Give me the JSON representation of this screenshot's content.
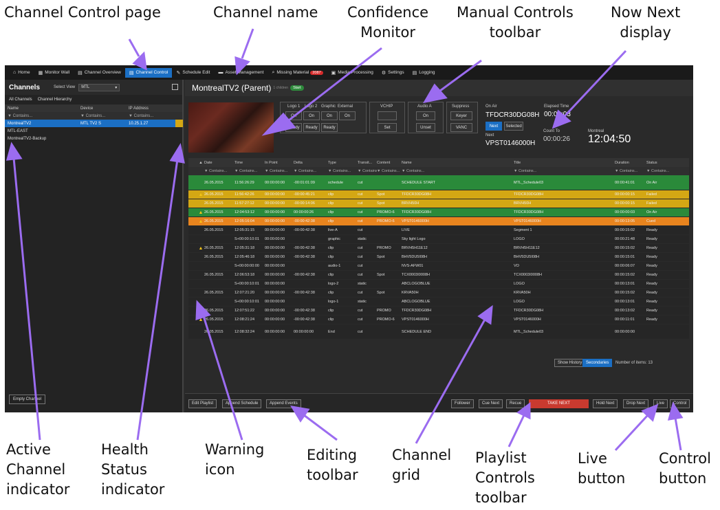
{
  "callouts": {
    "channel_control_page": "Channel Control page",
    "channel_name": "Channel name",
    "confidence_monitor": "Confidence\nMonitor",
    "manual_controls_toolbar": "Manual Controls\ntoolbar",
    "now_next_display": "Now Next\ndisplay",
    "active_channel_indicator": "Active\nChannel\nindicator",
    "health_status_indicator": "Health\nStatus\nindicator",
    "warning_icon": "Warning\nicon",
    "editing_toolbar": "Editing\ntoolbar",
    "channel_grid": "Channel\ngrid",
    "playlist_controls_toolbar": "Playlist\nControls\ntoolbar",
    "live_button": "Live\nbutton",
    "control_button": "Control\nbutton"
  },
  "nav": [
    {
      "icon": "⌂",
      "label": "Home"
    },
    {
      "icon": "▦",
      "label": "Monitor Wall"
    },
    {
      "icon": "▤",
      "label": "Channel Overview"
    },
    {
      "icon": "▤",
      "label": "Channel Control",
      "active": true
    },
    {
      "icon": "✎",
      "label": "Schedule Edit"
    },
    {
      "icon": "▬",
      "label": "Asset Management"
    },
    {
      "icon": "⌕",
      "label": "Missing Material",
      "badge": "2087"
    },
    {
      "icon": "▣",
      "label": "Media Processing"
    },
    {
      "icon": "⚙",
      "label": "Settings"
    },
    {
      "icon": "▤",
      "label": "Logging"
    }
  ],
  "left": {
    "title": "Channels",
    "select_view_label": "Select View",
    "select_view_value": "MTL",
    "tab_all": "All Channels",
    "tab_hierarchy": "Channel Hierarchy",
    "headers": {
      "name": "Name",
      "device": "Device",
      "ip": "IP Address"
    },
    "filters": {
      "name": "▼ Contains...",
      "device": "▼ Contains...",
      "ip": "▼ Contains..."
    },
    "channels": [
      {
        "name": "MontrealTV2",
        "device": "MTL TV2 S",
        "ip": "10.25.1.27",
        "active": true
      },
      {
        "name": "MTL-EAST",
        "device": "",
        "ip": ""
      },
      {
        "name": "MontrealTV2-Backup",
        "device": "",
        "ip": ""
      }
    ],
    "empty_channel": "Empty Channel"
  },
  "main": {
    "channel_name": "MontrealTV2 (Parent)",
    "channel_sub": "1 children",
    "status": "Start",
    "manual": {
      "logo1": "Logo 1",
      "logo2": "Logo 2",
      "graphic": "Graphic",
      "external": "External",
      "on": "On",
      "ready": "Ready",
      "vchip": "VCHIP",
      "set": "Set",
      "audio": "Audio A",
      "unset": "Unset",
      "suppress": "Suppress",
      "keyer": "Keyer",
      "vanc": "VANC"
    },
    "now_next": {
      "on_air_label": "On Air",
      "on_air_id": "TFDCR30DG08H",
      "elapsed_label": "Elapsed Time",
      "elapsed_value": "00:00:03",
      "next_btn": "Next",
      "selected_btn": "Selected",
      "next_label": "Next",
      "next_id": "VPST0146000H",
      "countto_label": "Count To",
      "countto_value": "00:00:26",
      "zone_label": "Montreal",
      "time": "12:04:50"
    },
    "grid_headers": [
      "",
      "▲",
      "Date",
      "Time",
      "In Point",
      "Delta",
      "Type",
      "Transit...",
      "Content",
      "Name",
      "Title",
      "Duration",
      "Status"
    ],
    "grid_filter": "▼ Contains...",
    "rows": [
      {
        "c": "green",
        "tall": true,
        "w": "",
        "date": "26.05.2015",
        "time": "11:56:26:29",
        "in": "00:00:00:00",
        "delta": "-00:01:01:09",
        "type": "schedule",
        "tr": "cut",
        "ct": "",
        "name": "SCHEDULE START",
        "title": "MTL_Schedule03",
        "dur": "00:00:41:01",
        "st": "On Air"
      },
      {
        "c": "yellow",
        "w": "▲",
        "date": "26.05.2015",
        "time": "11:56:42:26",
        "in": "00:00:00:00",
        "delta": "-00:00:45:21",
        "type": "clip",
        "tr": "cut",
        "ct": "Spot",
        "name": "TFDCR30DG08H",
        "title": "TFDCR30DG08H",
        "dur": "00:00:00:15",
        "st": "Failed"
      },
      {
        "c": "yellow",
        "w": "",
        "date": "26.05.2015",
        "time": "11:57:27:12",
        "in": "00:00:00:00",
        "delta": "-00:00:14:06",
        "type": "clip",
        "tr": "cut",
        "ct": "Spot",
        "name": "BRVH50H",
        "title": "BRVH50H",
        "dur": "00:00:00:15",
        "st": "Failed"
      },
      {
        "c": "green",
        "w": "▲",
        "date": "26.05.2015",
        "time": "12:04:53:12",
        "in": "00:00:00:00",
        "delta": "00:00:00:26",
        "type": "clip",
        "tr": "cut",
        "ct": "PROMO-6",
        "name": "TFDCR30DG08H",
        "title": "TFDCR30DG08H",
        "dur": "00:00:00:03",
        "st": "On Air"
      },
      {
        "c": "orange",
        "w": "▲",
        "date": "26.05.2015",
        "time": "12:05:16:04",
        "in": "00:00:00:00",
        "delta": "-00:00:42:38",
        "type": "clip",
        "tr": "cut",
        "ct": "PROMO-6",
        "name": "VPST0146000H",
        "title": "VPST0146000H",
        "dur": "00:00:13:05",
        "st": "Cued"
      },
      {
        "c": "dark",
        "w": "",
        "date": "26.05.2015",
        "time": "12:05:31:15",
        "in": "00:00:00:00",
        "delta": "-00:00:42:38",
        "type": "live-A",
        "tr": "cut",
        "ct": "",
        "name": "LIVE",
        "title": "Segment 1",
        "dur": "00:00:15:02",
        "st": "Ready"
      },
      {
        "c": "dark",
        "w": "",
        "date": "",
        "time": "S+00:00:10:01",
        "in": "00:00:00:00",
        "delta": "",
        "type": "graphic",
        "tr": "static",
        "ct": "",
        "name": "Sky light Logo",
        "title": "LOGO",
        "dur": "00:00:21:48",
        "st": "Ready"
      },
      {
        "c": "dark",
        "w": "▲",
        "date": "26.05.2015",
        "time": "12:05:31:18",
        "in": "00:00:00:00",
        "delta": "-00:00:42:38",
        "type": "clip",
        "tr": "cut",
        "ct": "PROMO",
        "name": "BRVH5H11E12",
        "title": "BRVH5H11E12",
        "dur": "00:00:15:02",
        "st": "Ready"
      },
      {
        "c": "dark",
        "w": "",
        "date": "26.05.2015",
        "time": "12:05:46:18",
        "in": "00:00:00:00",
        "delta": "-00:00:42:38",
        "type": "clip",
        "tr": "cut",
        "ct": "Spot",
        "name": "BHV5DU5I08H",
        "title": "BHV5DU5I08H",
        "dur": "00:00:15:01",
        "st": "Ready"
      },
      {
        "c": "dark",
        "w": "",
        "date": "",
        "time": "S+00:00:00:00",
        "in": "00:00:00:00",
        "delta": "",
        "type": "audio-1",
        "tr": "cut",
        "ct": "",
        "name": "NVS-AFW01",
        "title": "VO",
        "dur": "00:00:06:07",
        "st": "Ready"
      },
      {
        "c": "dark",
        "w": "",
        "date": "26.05.2015",
        "time": "12:06:53:18",
        "in": "00:00:00:00",
        "delta": "-00:00:42:38",
        "type": "clip",
        "tr": "cut",
        "ct": "Spot",
        "name": "TCX0003I0008H",
        "title": "TCX0003I0008H",
        "dur": "00:00:15:02",
        "st": "Ready"
      },
      {
        "c": "dark",
        "w": "",
        "date": "",
        "time": "S+00:00:10:01",
        "in": "00:00:00:00",
        "delta": "",
        "type": "logo-2",
        "tr": "static",
        "ct": "",
        "name": "ABCLOGOBLUE",
        "title": "LOGO",
        "dur": "00:00:13:01",
        "st": "Ready"
      },
      {
        "c": "dark",
        "w": "",
        "date": "26.05.2015",
        "time": "12:07:21:20",
        "in": "00:00:00:00",
        "delta": "-00:00:42:38",
        "type": "clip",
        "tr": "cut",
        "ct": "Spot",
        "name": "KRVA50H",
        "title": "KRVA50H",
        "dur": "00:00:15:02",
        "st": "Ready"
      },
      {
        "c": "dark",
        "w": "",
        "date": "",
        "time": "S+00:00:10:01",
        "in": "00:00:00:00",
        "delta": "",
        "type": "logo-1",
        "tr": "static",
        "ct": "",
        "name": "ABCLOGOBLUE",
        "title": "LOGO",
        "dur": "00:00:13:01",
        "st": "Ready"
      },
      {
        "c": "dark",
        "w": "",
        "date": "26.05.2015",
        "time": "12:07:51:22",
        "in": "00:00:00:00",
        "delta": "-00:00:42:38",
        "type": "clip",
        "tr": "cut",
        "ct": "PROMO",
        "name": "TFDCR30DG08H",
        "title": "TFDCR30DG08H",
        "dur": "00:00:13:02",
        "st": "Ready"
      },
      {
        "c": "dark",
        "w": "▲",
        "date": "26.05.2015",
        "time": "12:08:21:24",
        "in": "00:00:00:00",
        "delta": "-00:00:42:38",
        "type": "clip",
        "tr": "cut",
        "ct": "PROMO-6",
        "name": "VPST0146000H",
        "title": "VPST0146000H",
        "dur": "00:00:11:01",
        "st": "Ready"
      },
      {
        "c": "dark",
        "tall": true,
        "w": "",
        "date": "26.05.2015",
        "time": "12:08:32:24",
        "in": "00:00:00:00",
        "delta": "00:00:00:00",
        "type": "End",
        "tr": "cut",
        "ct": "",
        "name": "SCHEDULE END",
        "title": "MTL_Schedule03",
        "dur": "00:00:00:00",
        "st": ""
      }
    ],
    "show_history": "Show History",
    "secondaries": "Secondaries",
    "items_label": "Number of items: 13",
    "edit": {
      "edit_playlist": "Edit Playlist",
      "append_schedule": "Append Schedule",
      "append_events": "Append Events"
    },
    "playlist": {
      "follower": "Follower",
      "cue_next": "Cue Next",
      "recue": "Recue",
      "take_next": "TAKE NEXT",
      "hold_next": "Hold Next",
      "drop_next": "Drop Next",
      "live": "Live",
      "control": "Control"
    }
  }
}
